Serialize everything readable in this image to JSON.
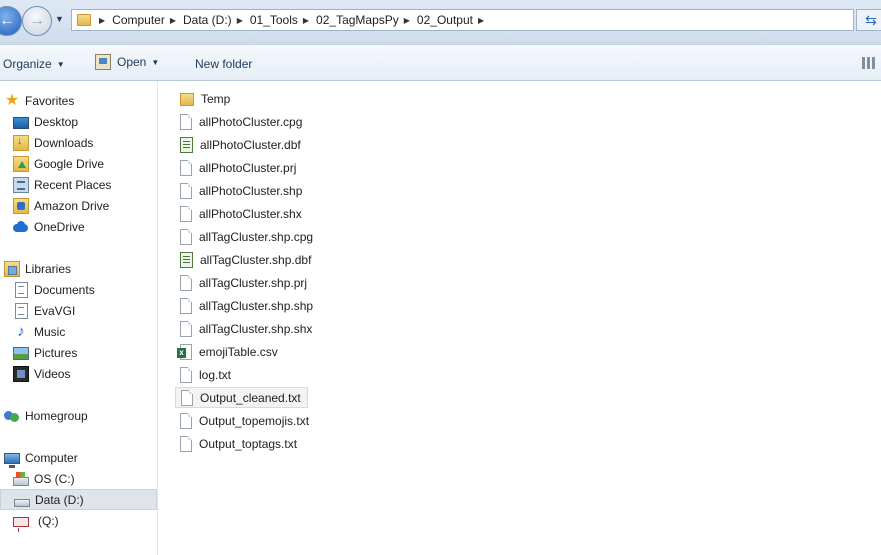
{
  "address_bar": {
    "breadcrumbs": [
      "Computer",
      "Data (D:)",
      "01_Tools",
      "02_TagMapsPy",
      "02_Output"
    ]
  },
  "toolbar": {
    "organize_label": "Organize",
    "open_label": "Open",
    "new_folder_label": "New folder"
  },
  "nav": {
    "favorites": {
      "label": "Favorites",
      "items": [
        {
          "label": "Desktop",
          "icon": "desktop-icon"
        },
        {
          "label": "Downloads",
          "icon": "downloads-icon"
        },
        {
          "label": "Google Drive",
          "icon": "google-drive-icon"
        },
        {
          "label": "Recent Places",
          "icon": "recent-places-icon"
        },
        {
          "label": "Amazon Drive",
          "icon": "amazon-drive-icon"
        },
        {
          "label": "OneDrive",
          "icon": "onedrive-icon"
        }
      ]
    },
    "libraries": {
      "label": "Libraries",
      "items": [
        {
          "label": "Documents",
          "icon": "documents-icon"
        },
        {
          "label": "EvaVGI",
          "icon": "library-icon"
        },
        {
          "label": "Music",
          "icon": "music-icon"
        },
        {
          "label": "Pictures",
          "icon": "pictures-icon"
        },
        {
          "label": "Videos",
          "icon": "videos-icon"
        }
      ]
    },
    "homegroup": {
      "label": "Homegroup"
    },
    "computer": {
      "label": "Computer",
      "items": [
        {
          "label": "OS (C:)",
          "icon": "os-drive-icon"
        },
        {
          "label": "Data (D:)",
          "icon": "data-drive-icon",
          "selected": true
        },
        {
          "label": "(Q:)",
          "icon": "network-drive-icon"
        }
      ]
    }
  },
  "files": [
    {
      "name": "Temp",
      "type": "folder"
    },
    {
      "name": "allPhotoCluster.cpg",
      "type": "generic"
    },
    {
      "name": "allPhotoCluster.dbf",
      "type": "dbf"
    },
    {
      "name": "allPhotoCluster.prj",
      "type": "generic"
    },
    {
      "name": "allPhotoCluster.shp",
      "type": "generic"
    },
    {
      "name": "allPhotoCluster.shx",
      "type": "generic"
    },
    {
      "name": "allTagCluster.shp.cpg",
      "type": "generic"
    },
    {
      "name": "allTagCluster.shp.dbf",
      "type": "dbf"
    },
    {
      "name": "allTagCluster.shp.prj",
      "type": "generic"
    },
    {
      "name": "allTagCluster.shp.shp",
      "type": "generic"
    },
    {
      "name": "allTagCluster.shp.shx",
      "type": "generic"
    },
    {
      "name": "emojiTable.csv",
      "type": "excel"
    },
    {
      "name": "log.txt",
      "type": "generic"
    },
    {
      "name": "Output_cleaned.txt",
      "type": "generic",
      "selected": true
    },
    {
      "name": "Output_topemojis.txt",
      "type": "generic"
    },
    {
      "name": "Output_toptags.txt",
      "type": "generic"
    }
  ]
}
